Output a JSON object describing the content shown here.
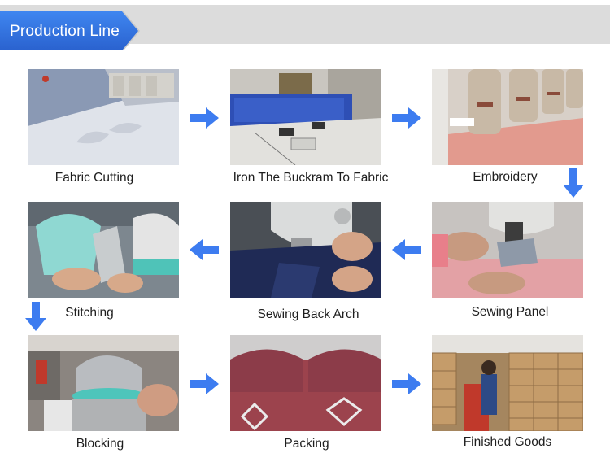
{
  "title": "Production Line",
  "steps": [
    {
      "label": "Fabric Cutting"
    },
    {
      "label": "Iron The Buckram To Fabric"
    },
    {
      "label": "Embroidery"
    },
    {
      "label": "Sewing Panel"
    },
    {
      "label": "Sewing Back Arch"
    },
    {
      "label": "Stitching"
    },
    {
      "label": "Blocking"
    },
    {
      "label": "Packing"
    },
    {
      "label": "Finished Goods"
    }
  ],
  "colors": {
    "accent": "#2f6ee0",
    "arrow": "#3d7cf0",
    "band": "#dcdcdc"
  }
}
